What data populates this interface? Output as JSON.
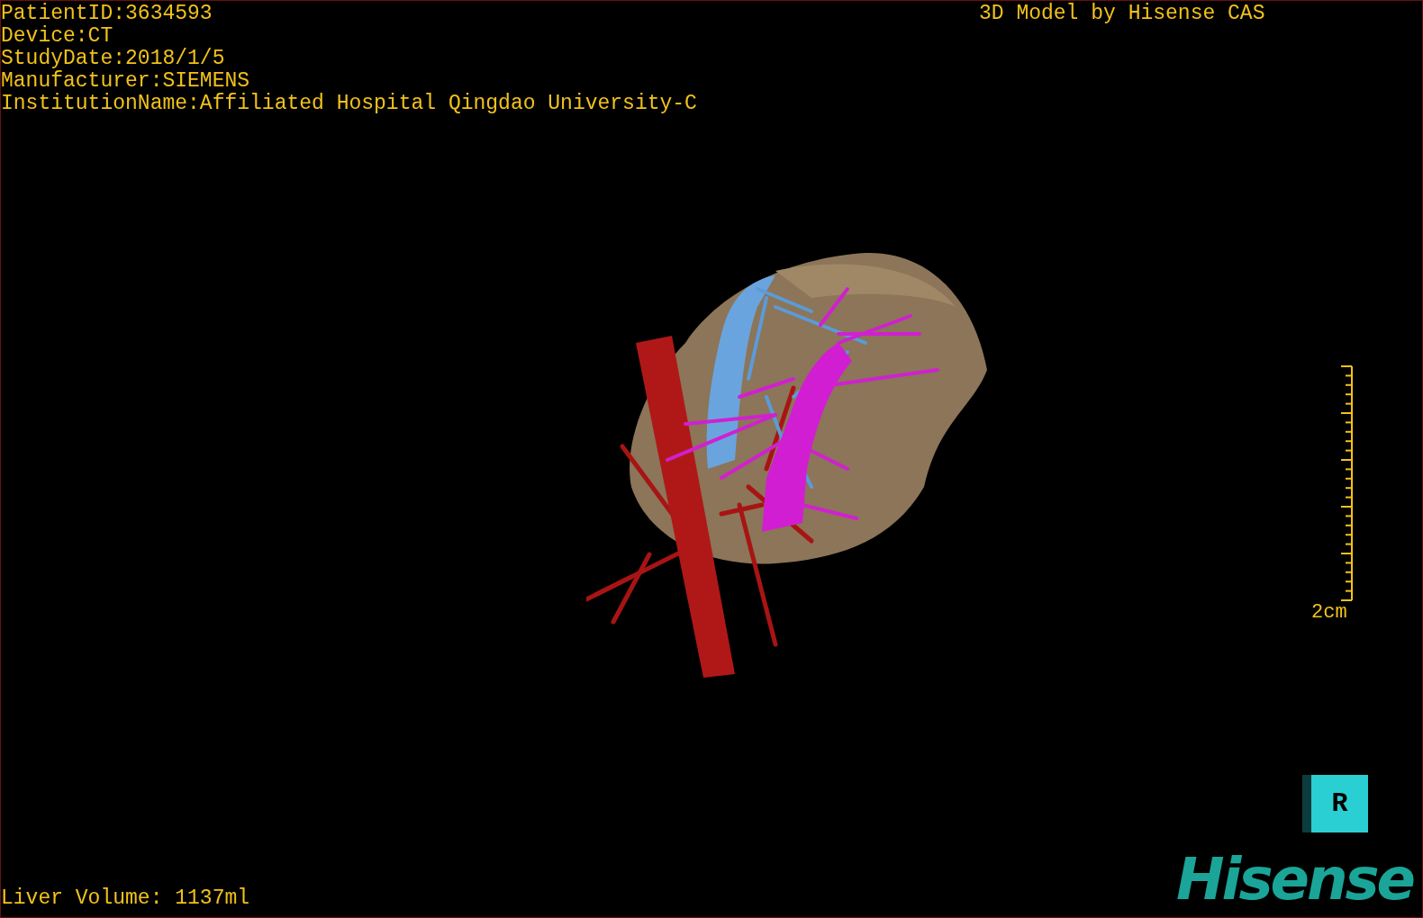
{
  "info_lines": [
    "PatientID:3634593",
    "Device:CT",
    "StudyDate:2018/1/5",
    "Manufacturer:SIEMENS",
    "InstitutionName:Affiliated Hospital Qingdao University-C"
  ],
  "credit": "3D Model by Hisense CAS",
  "scale_bar": {
    "label": "2cm"
  },
  "orientation_cube": {
    "label": "R"
  },
  "logo": {
    "text": "Hisense"
  },
  "measurement": "Liver Volume: 1137ml"
}
